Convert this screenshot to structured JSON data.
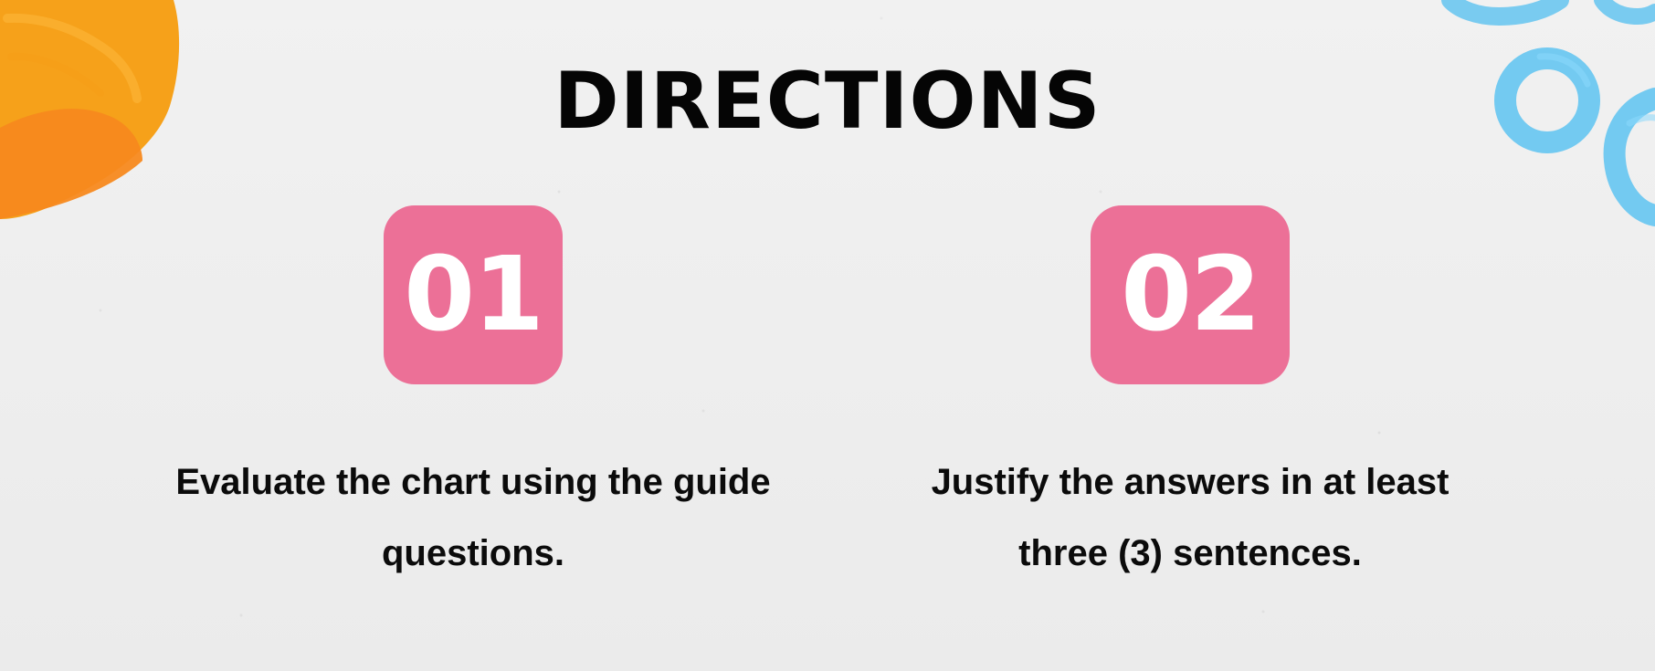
{
  "page": {
    "title": "DIRECTIONS"
  },
  "steps": [
    {
      "number": "01",
      "text": "Evaluate the chart using the guide\nquestions."
    },
    {
      "number": "02",
      "text": "Justify the answers in at least\nthree (3) sentences."
    }
  ],
  "theme": {
    "background": "#efefef",
    "badge_color": "#ec7097",
    "title_color": "#050505",
    "text_color": "#0b0b0b",
    "orange_decor": "#f7a51d",
    "blue_decor": "#6cc7f0"
  }
}
